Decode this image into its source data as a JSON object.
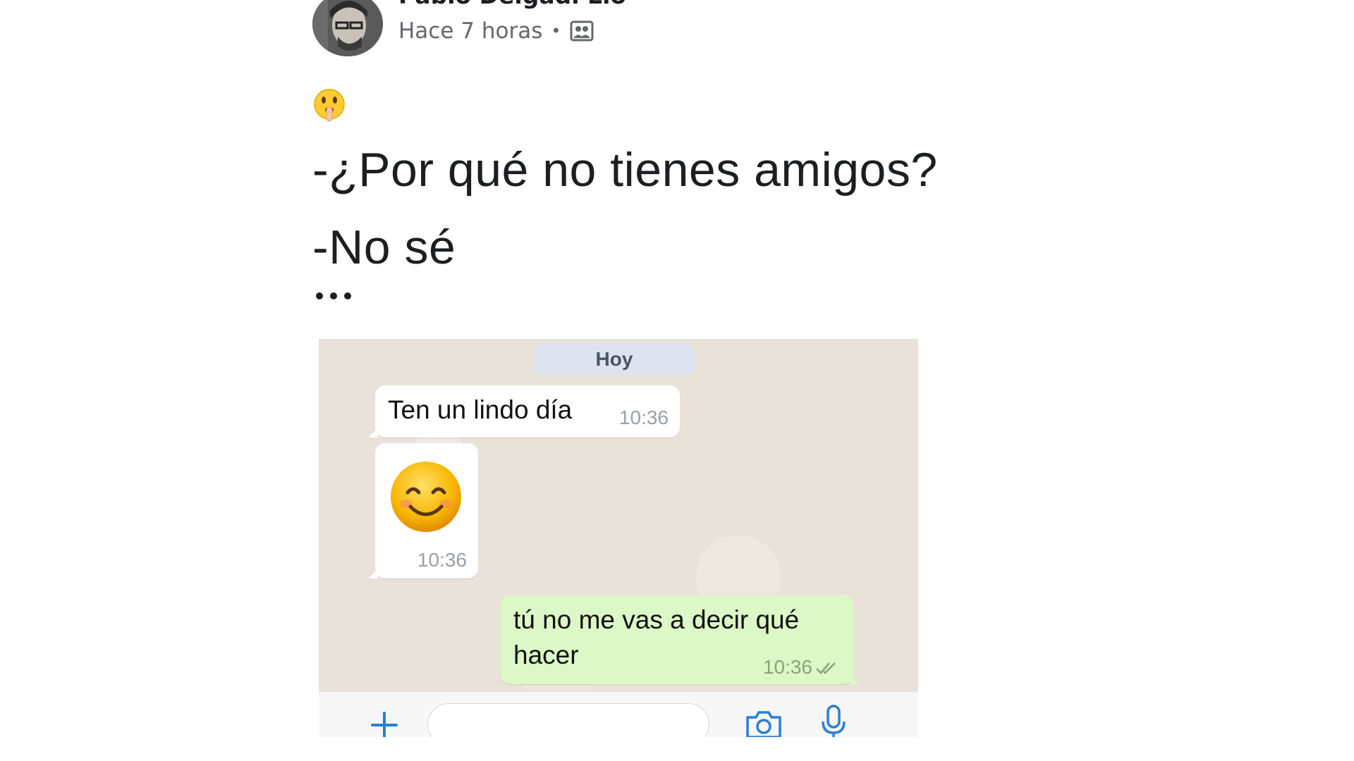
{
  "post": {
    "author": "Pablo Delgadi Lio",
    "time": "Hace 7 horas",
    "separator": "•",
    "audience_icon": "friends-icon",
    "more_icon": "more-horizontal-icon",
    "leading_emoji": "shushing-face-emoji",
    "lines": [
      "-¿Por qué no tienes amigos?",
      "-No sé"
    ],
    "trailing": "ellipsis"
  },
  "whatsapp": {
    "date_label": "Hoy",
    "messages": [
      {
        "direction": "incoming",
        "text": "Ten un lindo día",
        "time": "10:36"
      },
      {
        "direction": "incoming",
        "emoji": "smiling-face-emoji",
        "time": "10:36"
      },
      {
        "direction": "outgoing",
        "text": "tú no me vas a decir qué hacer",
        "time": "10:36",
        "status": "read"
      }
    ],
    "input_bar": {
      "plus_icon": "plus-icon",
      "placeholder": "",
      "camera_icon": "camera-icon",
      "mic_icon": "microphone-icon"
    },
    "colors": {
      "outgoing_bubble": "#dcf8c6",
      "incoming_bubble": "#ffffff",
      "chat_bg": "#e9e2d8"
    }
  }
}
